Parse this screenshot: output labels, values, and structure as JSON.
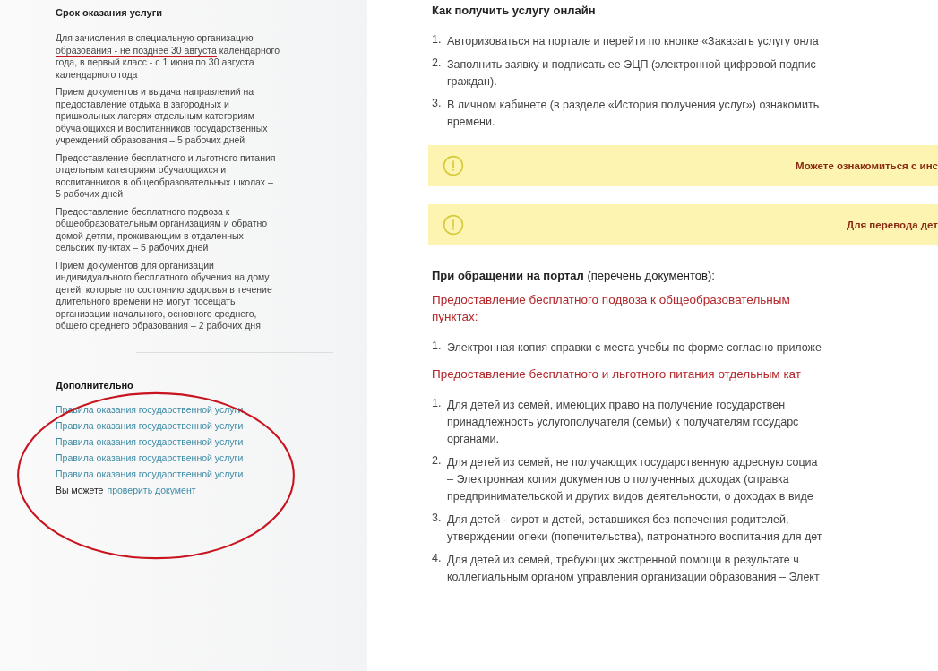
{
  "sidebar": {
    "term_title": "Срок оказания услуги",
    "term_items": [
      {
        "parts": [
          {
            "text": "Для зачисления в специальную организацию ",
            "marked": false
          },
          {
            "text": "образования - не позднее 30 августа",
            "marked": true
          },
          {
            "text": " календарного года, в первый класс - с 1 июня по 30 августа календарного года",
            "marked": false
          }
        ]
      },
      {
        "parts": [
          {
            "text": "Прием документов и выдача направлений на предоставление отдыха в загородных и пришкольных лагерях отдельным категориям обучающихся и воспитанников государственных учреждений образования – 5 рабочих дней",
            "marked": false
          }
        ]
      },
      {
        "parts": [
          {
            "text": "Предоставление бесплатного и льготного питания отдельным категориям обучающихся и воспитанников в общеобразовательных школах – 5 рабочих дней",
            "marked": false
          }
        ]
      },
      {
        "parts": [
          {
            "text": "Предоставление бесплатного подвоза к общеобразовательным организациям и обратно домой детям, проживающим в отдаленных сельских пунктах – 5 рабочих дней",
            "marked": false
          }
        ]
      },
      {
        "parts": [
          {
            "text": "Прием документов для организации индивидуального бесплатного обучения на дому детей, которые по состоянию здоровья в течение длительного времени не могут посещать организации начального, основного среднего, общего среднего образования – 2 рабочих дня",
            "marked": false
          }
        ]
      }
    ],
    "extra": {
      "title": "Дополнительно",
      "circled": true,
      "links": [
        "Правила оказания государственной услуги",
        "Правила оказания государственной услуги",
        "Правила оказания государственной услуги",
        "Правила оказания государственной услуги",
        "Правила оказания государственной услуги"
      ],
      "check_prefix": "Вы можете",
      "check_link": "проверить документ"
    }
  },
  "main": {
    "heading": "Как получить услугу онлайн",
    "steps": [
      {
        "num": "1.",
        "lines": [
          "Авторизоваться на портале и перейти по кнопке «Заказать услугу онла"
        ]
      },
      {
        "num": "2.",
        "lines": [
          "Заполнить заявку и подписать ее ЭЦП (электронной цифровой подпис",
          "граждан)."
        ]
      },
      {
        "num": "3.",
        "lines": [
          "В личном кабинете (в разделе «История получения услуг») ознакомить",
          "времени."
        ]
      }
    ],
    "notices": [
      "Можете ознакомиться с инс",
      "Для перевода дет"
    ],
    "portal_note": "**При обращении на портал** (перечень документов):",
    "sections": [
      {
        "title_lines": [
          "Предоставление бесплатного подвоза к общеобразовательным",
          "пунктах:"
        ],
        "items": [
          {
            "num": "1.",
            "lines": [
              "Электронная копия справки с места учебы по форме согласно приложе"
            ]
          }
        ]
      },
      {
        "title_lines": [
          "Предоставление бесплатного и льготного питания отдельным кат"
        ],
        "items": [
          {
            "num": "1.",
            "lines": [
              "Для детей из семей, имеющих право на получение государствен",
              "принадлежность услугополучателя (семьи) к получателям государс",
              "органами."
            ]
          },
          {
            "num": "2.",
            "lines": [
              "Для детей из семей, не получающих государственную адресную социа",
              "– Электронная копия документов о полученных доходах (справка",
              "предпринимательской и других видов деятельности, о доходах в виде"
            ]
          },
          {
            "num": "3.",
            "lines": [
              "Для детей - сирот и детей, оставшихся без попечения родителей,",
              "утверждении опеки (попечительства), патронатного воспитания для дет"
            ]
          },
          {
            "num": "4.",
            "lines": [
              "Для детей из семей, требующих экстренной помощи в результате ч",
              "коллегиальным органом управления организации образования – Элект"
            ]
          }
        ]
      }
    ]
  }
}
